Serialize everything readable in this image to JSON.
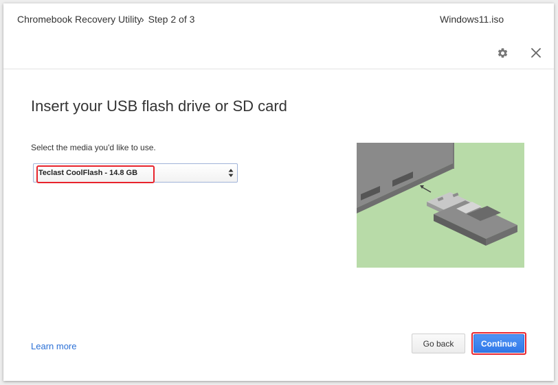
{
  "header": {
    "app_title": "Chromebook Recovery Utility",
    "step_chevron": "›",
    "step_label": "Step 2 of 3",
    "filename": "Windows11.iso"
  },
  "icons": {
    "settings": "gear-icon",
    "close": "close-icon",
    "select_arrows": "updown-arrows-icon"
  },
  "main": {
    "heading": "Insert your USB flash drive or SD card",
    "instruction": "Select the media you'd like to use.",
    "media_select": {
      "selected": "Teclast CoolFlash - 14.8 GB"
    }
  },
  "footer": {
    "learn_more": "Learn more",
    "back_label": "Go back",
    "continue_label": "Continue"
  },
  "colors": {
    "accent_blue": "#3178e8",
    "highlight_red": "#e8232c",
    "illustration_bg": "#b8dba8"
  }
}
